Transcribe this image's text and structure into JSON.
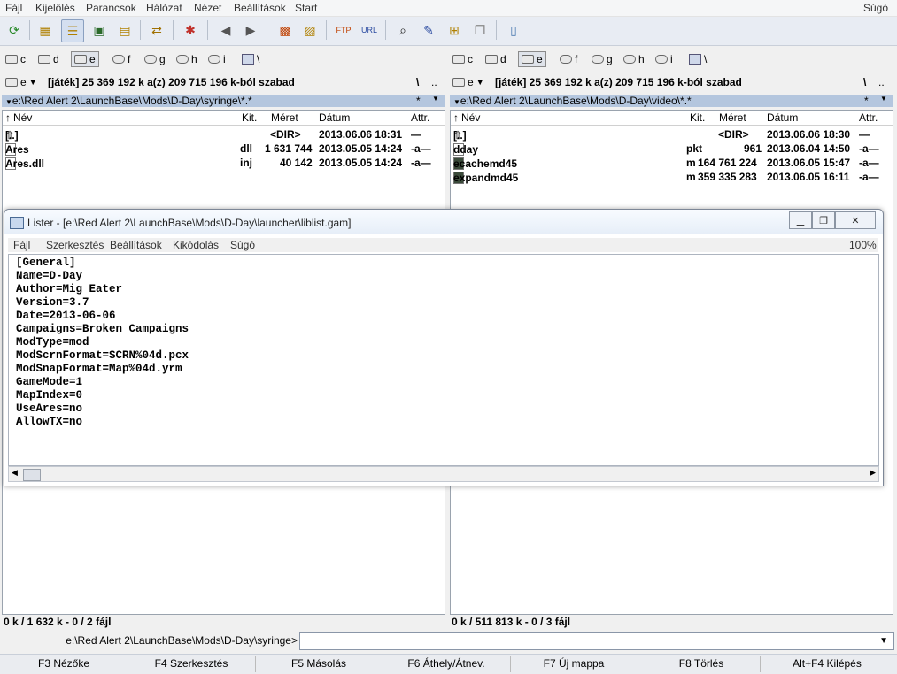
{
  "menubar": {
    "items": [
      "Fájl",
      "Kijelölés",
      "Parancsok",
      "Hálózat",
      "Nézet",
      "Beállítások",
      "Start"
    ],
    "help": "Súgó"
  },
  "toolbar": {
    "icons": [
      "refresh-icon",
      "brief-view-icon",
      "full-view-icon",
      "thumbnail-view-icon",
      "tree-view-icon",
      "compare-icon",
      "pack-icon",
      "back-icon",
      "forward-icon",
      "pack-files-icon",
      "unpack-files-icon",
      "ftp-connect-icon",
      "url-connect-icon",
      "search-icon",
      "rename-icon",
      "sync-dirs-icon",
      "copy-names-icon",
      "notepad-icon"
    ]
  },
  "left": {
    "drives": [
      "c",
      "d",
      "e",
      "f",
      "g",
      "h",
      "i",
      "\\"
    ],
    "selected_drive": "e",
    "drive_combo": "e",
    "volume_info": "[játék]  25 369 192 k a(z) 209 715 196 k-ból szabad",
    "root_btn": "\\",
    "up_btn": "..",
    "path": "e:\\Red Alert 2\\LaunchBase\\Mods\\D-Day\\syringe\\*.*",
    "star": "*",
    "columns": {
      "name": "Név",
      "ext": "Kit.",
      "size": "Méret",
      "date": "Dátum",
      "attr": "Attr."
    },
    "files": [
      {
        "name": "[..]",
        "ext": "",
        "size": "<DIR>",
        "date": "2013.06.06 18:31",
        "attr": "—"
      },
      {
        "name": "Ares",
        "ext": "dll",
        "size": "1 631 744",
        "date": "2013.05.05 14:24",
        "attr": "-a—"
      },
      {
        "name": "Ares.dll",
        "ext": "inj",
        "size": "40 142",
        "date": "2013.05.05 14:24",
        "attr": "-a—"
      }
    ],
    "status": "0 k / 1 632 k - 0 / 2 fájl"
  },
  "right": {
    "drives": [
      "c",
      "d",
      "e",
      "f",
      "g",
      "h",
      "i",
      "\\"
    ],
    "selected_drive": "e",
    "drive_combo": "e",
    "volume_info": "[játék]  25 369 192 k a(z) 209 715 196 k-ból szabad",
    "root_btn": "\\",
    "up_btn": "..",
    "path": "e:\\Red Alert 2\\LaunchBase\\Mods\\D-Day\\video\\*.*",
    "star": "*",
    "columns": {
      "name": "Név",
      "ext": "Kit.",
      "size": "Méret",
      "date": "Dátum",
      "attr": "Attr."
    },
    "files": [
      {
        "name": "[..]",
        "ext": "",
        "size": "<DIR>",
        "date": "2013.06.06 18:30",
        "attr": "—"
      },
      {
        "name": "dday",
        "ext": "pkt",
        "size": "961",
        "date": "2013.06.04 14:50",
        "attr": "-a—"
      },
      {
        "name": "ecachemd45",
        "ext": "mix",
        "size": "164 761 224",
        "date": "2013.06.05 15:47",
        "attr": "-a—"
      },
      {
        "name": "expandmd45",
        "ext": "mix",
        "size": "359 335 283",
        "date": "2013.06.05 16:11",
        "attr": "-a—"
      }
    ],
    "status": "0 k / 511 813 k - 0 / 3 fájl"
  },
  "lister": {
    "title": "Lister - [e:\\Red Alert 2\\LaunchBase\\Mods\\D-Day\\launcher\\liblist.gam]",
    "menu": [
      "Fájl",
      "Szerkesztés",
      "Beállítások",
      "Kikódolás",
      "Súgó"
    ],
    "zoom": "100%",
    "content": "[General]\nName=D-Day\nAuthor=Mig Eater\nVersion=3.7\nDate=2013-06-06\nCampaigns=Broken Campaigns\nModType=mod\nModScrnFormat=SCRN%04d.pcx\nModSnapFormat=Map%04d.yrm\nGameMode=1\nMapIndex=0\nUseAres=no\nAllowTX=no"
  },
  "cmdline": {
    "label": "e:\\Red Alert 2\\LaunchBase\\Mods\\D-Day\\syringe>",
    "value": ""
  },
  "fkeys": [
    "F3 Nézőke",
    "F4 Szerkesztés",
    "F5 Másolás",
    "F6 Áthely/Átnev.",
    "F7 Új mappa",
    "F8 Törlés",
    "Alt+F4 Kilépés"
  ]
}
